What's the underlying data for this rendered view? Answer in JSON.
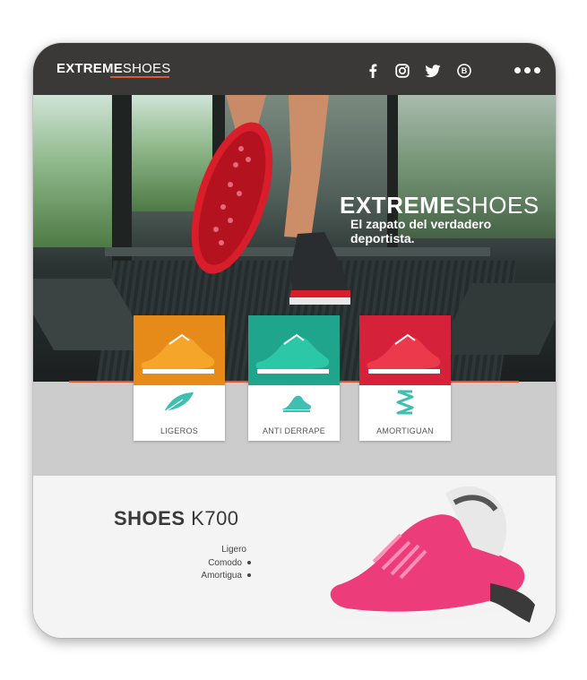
{
  "header": {
    "logo_bold": "EXTREME",
    "logo_light": "SHOES",
    "social": [
      "facebook-icon",
      "instagram-icon",
      "twitter-icon",
      "behance-icon"
    ],
    "menu_icon": "more-icon"
  },
  "hero": {
    "title_bold": "EXTREME",
    "title_light": "SHOES",
    "subtitle": "El zapato del verdadero deportista."
  },
  "features": [
    {
      "label": "LIGEROS",
      "color": "#e68a1a",
      "icon": "feather-icon"
    },
    {
      "label": "ANTI DERRAPE",
      "color": "#1ea58b",
      "icon": "shoe-icon"
    },
    {
      "label": "AMORTIGUAN",
      "color": "#d6213a",
      "icon": "spring-icon"
    }
  ],
  "product": {
    "title_bold": "SHOES",
    "title_light": "K700",
    "features": [
      "Ligero",
      "Comodo",
      "Amortigua"
    ]
  },
  "colors": {
    "header_bg": "#3b3838",
    "accent": "#e4572e",
    "icon_teal": "#3fbfb0"
  }
}
